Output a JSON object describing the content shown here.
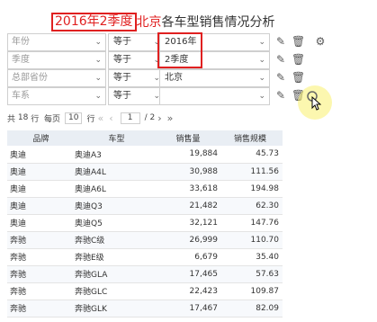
{
  "title": {
    "highlight": "2016年2季度",
    "city": "北京",
    "rest": "各车型销售情况分析"
  },
  "filters": [
    {
      "label": "年份",
      "operator": "等于",
      "value": "2016年"
    },
    {
      "label": "季度",
      "operator": "等于",
      "value": "2季度"
    },
    {
      "label": "总部省份",
      "operator": "等于",
      "value": "北京"
    },
    {
      "label": "车系",
      "operator": "等于",
      "value": ""
    }
  ],
  "icons": {
    "edit": "pencil-icon",
    "delete": "trash-icon",
    "settings": "gear-icon",
    "add": "add-circle-icon",
    "pointer": "cursor-icon"
  },
  "pager": {
    "total_prefix": "共",
    "total": "18",
    "total_suffix": "行",
    "per_page_label": "每页",
    "per_page": "10",
    "per_page_suffix": "行",
    "first": "«",
    "prev": "‹",
    "current_page": "1",
    "of": "/ 2",
    "next": "›",
    "last": "»"
  },
  "table": {
    "headers": [
      "品牌",
      "车型",
      "销售量",
      "销售规模"
    ],
    "rows": [
      [
        "奥迪",
        "奥迪A3",
        "19,884",
        "45.73"
      ],
      [
        "奥迪",
        "奥迪A4L",
        "30,988",
        "111.56"
      ],
      [
        "奥迪",
        "奥迪A6L",
        "33,618",
        "194.98"
      ],
      [
        "奥迪",
        "奥迪Q3",
        "21,482",
        "62.30"
      ],
      [
        "奥迪",
        "奥迪Q5",
        "32,121",
        "147.76"
      ],
      [
        "奔驰",
        "奔驰C级",
        "26,999",
        "110.70"
      ],
      [
        "奔驰",
        "奔驰E级",
        "6,679",
        "35.40"
      ],
      [
        "奔驰",
        "奔驰GLA",
        "17,465",
        "57.63"
      ],
      [
        "奔驰",
        "奔驰GLC",
        "22,423",
        "109.87"
      ],
      [
        "奔驰",
        "奔驰GLK",
        "17,467",
        "82.09"
      ]
    ]
  },
  "colors": {
    "highlight": "#e02020",
    "header_bg": "#e9eef4",
    "cursor_glow": "#f5ec6e"
  }
}
